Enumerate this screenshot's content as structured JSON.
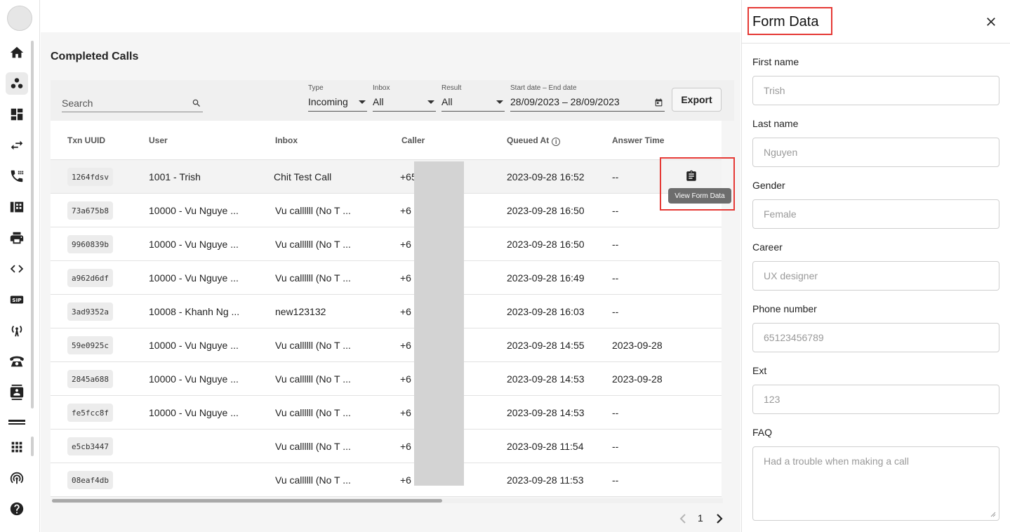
{
  "page": {
    "title": "Completed Calls"
  },
  "toolbar": {
    "search_placeholder": "Search",
    "filters": [
      {
        "label": "Type",
        "value": "Incoming"
      },
      {
        "label": "Inbox",
        "value": "All"
      },
      {
        "label": "Result",
        "value": "All"
      },
      {
        "label": "Start date – End date",
        "value": "28/09/2023 – 28/09/2023"
      }
    ],
    "export_label": "Export"
  },
  "table": {
    "columns": [
      "Txn UUID",
      "User",
      "Inbox",
      "Caller",
      "Queued At",
      "Answer Time"
    ],
    "rows": [
      {
        "uuid": "1264fdsv",
        "user": "1001 - Trish",
        "inbox": "Chit Test Call",
        "caller": "+65",
        "queued": "2023-09-28 16:52",
        "answer": "--"
      },
      {
        "uuid": "73a675b8",
        "user": "10000 - Vu Nguye ...",
        "inbox": "Vu callllll (No T ...",
        "caller": "+6",
        "queued": "2023-09-28 16:50",
        "answer": "--"
      },
      {
        "uuid": "9960839b",
        "user": "10000 - Vu Nguye ...",
        "inbox": "Vu callllll (No T ...",
        "caller": "+6",
        "queued": "2023-09-28 16:50",
        "answer": "--"
      },
      {
        "uuid": "a962d6df",
        "user": "10000 - Vu Nguye ...",
        "inbox": "Vu callllll (No T ...",
        "caller": "+6",
        "queued": "2023-09-28 16:49",
        "answer": "--"
      },
      {
        "uuid": "3ad9352a",
        "user": "10008 - Khanh Ng ...",
        "inbox": "new123132",
        "caller": "+6",
        "queued": "2023-09-28 16:03",
        "answer": "--"
      },
      {
        "uuid": "59e0925c",
        "user": "10000 - Vu Nguye ...",
        "inbox": "Vu callllll (No T ...",
        "caller": "+6",
        "queued": "2023-09-28 14:55",
        "answer": "2023-09-28"
      },
      {
        "uuid": "2845a688",
        "user": "10000 - Vu Nguye ...",
        "inbox": "Vu callllll (No T ...",
        "caller": "+6",
        "queued": "2023-09-28 14:53",
        "answer": "2023-09-28"
      },
      {
        "uuid": "fe5fcc8f",
        "user": "10000 - Vu Nguye ...",
        "inbox": "Vu callllll (No T ...",
        "caller": "+6",
        "queued": "2023-09-28 14:53",
        "answer": "--"
      },
      {
        "uuid": "e5cb3447",
        "user": "",
        "inbox": "Vu callllll (No T ...",
        "caller": "+6",
        "queued": "2023-09-28 11:54",
        "answer": "--"
      },
      {
        "uuid": "08eaf4db",
        "user": "",
        "inbox": "Vu callllll (No T ...",
        "caller": "+6",
        "queued": "2023-09-28 11:53",
        "answer": "--"
      }
    ],
    "tooltip": "View Form Data"
  },
  "pagination": {
    "current": "1"
  },
  "panel": {
    "title": "Form Data",
    "fields": [
      {
        "label": "First name",
        "value": "Trish"
      },
      {
        "label": "Last name",
        "value": "Nguyen"
      },
      {
        "label": "Gender",
        "value": "Female"
      },
      {
        "label": "Career",
        "value": "UX designer"
      },
      {
        "label": "Phone number",
        "value": "65123456789"
      },
      {
        "label": "Ext",
        "value": "123"
      },
      {
        "label": "FAQ",
        "value": "Had a trouble when making a call"
      }
    ]
  },
  "icons": [
    "home-icon",
    "contacts-icon",
    "dashboard-icon",
    "transfer-icon",
    "call-log-icon",
    "switchboard-icon",
    "printer-icon",
    "code-icon",
    "sip-icon",
    "antenna-icon",
    "telephone-icon",
    "contact-card-icon",
    "apps-grid-icon",
    "broadcast-icon",
    "help-icon"
  ]
}
